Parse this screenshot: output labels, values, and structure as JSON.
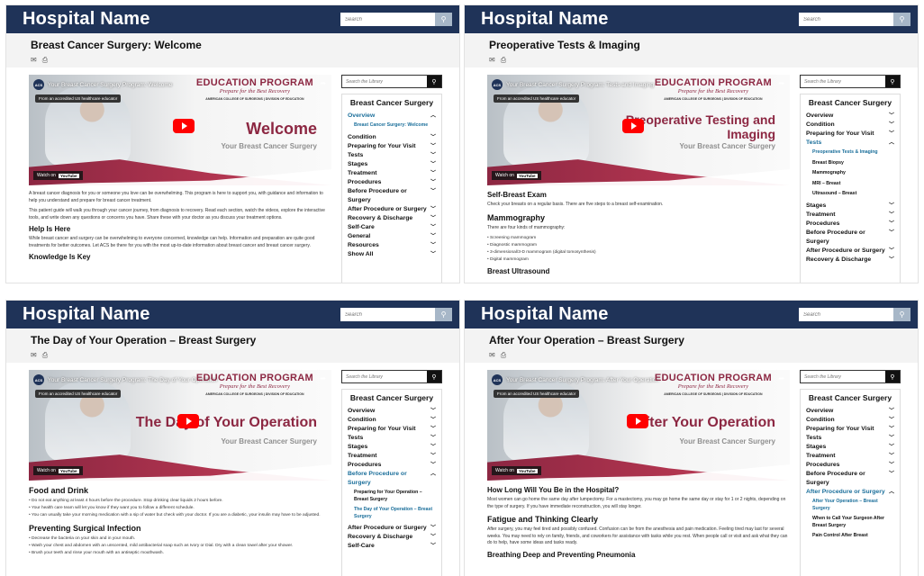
{
  "brand": "Hospital Name",
  "search_placeholder": "Search",
  "library_search_placeholder": "Search the Library",
  "panels": [
    {
      "page_title": "Breast Cancer Surgery: Welcome",
      "video": {
        "title": "Your Breast Cancer Surgery Program: Welcome",
        "edu_tag": "From an accredited US healthcare educator",
        "main_text": "Welcome",
        "sub_text": "Your Breast Cancer Surgery",
        "watch": "Watch on",
        "youtube": "YouTube"
      },
      "content": {
        "p1": "A breast cancer diagnosis for you or someone you love can be overwhelming. This program is here to support you, with guidance and information to help you understand and prepare for breast cancer treatment.",
        "p2": "This patient guide will walk you through your cancer journey, from diagnosis to recovery. Read each section, watch the videos, explore the interactive tools, and write down any questions or concerns you have. Share these with your doctor as you discuss your treatment options.",
        "h1": "Help Is Here",
        "p3": "While breast cancer and surgery can be overwhelming to everyone concerned, knowledge can help. Information and preparation are quite good treatments for better outcomes. Let ACS be there for you with the most up-to-date information about breast cancer and breast cancer surgery.",
        "h2": "Knowledge Is Key"
      },
      "nav": {
        "title": "Breast Cancer Surgery",
        "items": [
          {
            "label": "Overview",
            "chev": "︿",
            "active": true
          },
          {
            "label": "Condition",
            "chev": "﹀"
          },
          {
            "label": "Preparing for Your Visit",
            "chev": "﹀"
          },
          {
            "label": "Tests",
            "chev": "﹀"
          },
          {
            "label": "Stages",
            "chev": "﹀"
          },
          {
            "label": "Treatment",
            "chev": "﹀"
          },
          {
            "label": "Procedures",
            "chev": "﹀"
          },
          {
            "label": "Before Procedure or Surgery",
            "chev": "﹀"
          },
          {
            "label": "After Procedure or Surgery",
            "chev": "﹀"
          },
          {
            "label": "Recovery & Discharge",
            "chev": "﹀"
          },
          {
            "label": "Self-Care",
            "chev": "﹀"
          },
          {
            "label": "General",
            "chev": "﹀"
          },
          {
            "label": "Resources",
            "chev": "﹀"
          },
          {
            "label": "Show All",
            "chev": "﹀"
          }
        ],
        "sub": [
          "Breast Cancer Surgery: Welcome"
        ]
      }
    },
    {
      "page_title": "Preoperative Tests & Imaging",
      "video": {
        "title": "Your Breast Cancer Surgery Program: Tests and Imaging",
        "edu_tag": "From an accredited US healthcare educator",
        "main_text": "Preoperative Testing and Imaging",
        "sub_text": "Your Breast Cancer Surgery",
        "watch": "Watch on",
        "youtube": "YouTube"
      },
      "content": {
        "h1": "Self-Breast Exam",
        "p1": "Check your breasts on a regular basis. There are five steps to a breast self-examination.",
        "h2": "Mammography",
        "p2": "There are four kinds of mammography:",
        "list": [
          "Screening mammogram",
          "Diagnostic mammogram",
          "3-dimensional/3-D mammogram (digital tomosynthesis)",
          "Digital mammogram"
        ],
        "h3": "Breast Ultrasound"
      },
      "nav": {
        "title": "Breast Cancer Surgery",
        "items": [
          {
            "label": "Overview",
            "chev": "﹀"
          },
          {
            "label": "Condition",
            "chev": "﹀"
          },
          {
            "label": "Preparing for Your Visit",
            "chev": "﹀"
          },
          {
            "label": "Tests",
            "chev": "︿",
            "active": true
          },
          {
            "label": "Stages",
            "chev": "﹀"
          },
          {
            "label": "Treatment",
            "chev": "﹀"
          },
          {
            "label": "Procedures",
            "chev": "﹀"
          },
          {
            "label": "Before Procedure or Surgery",
            "chev": "﹀"
          },
          {
            "label": "After Procedure or Surgery",
            "chev": "﹀"
          },
          {
            "label": "Recovery & Discharge",
            "chev": "﹀"
          }
        ],
        "sub": [
          "Preoperative Tests & Imaging",
          "Breast Biopsy",
          "Mammography",
          "MRI – Breast",
          "Ultrasound – Breast"
        ]
      }
    },
    {
      "page_title": "The Day of Your Operation – Breast Surgery",
      "video": {
        "title": "Your Breast Cancer Surgery Program: The Day of Your Operation",
        "edu_tag": "From an accredited US healthcare educator",
        "main_text": "The Day of Your Operation",
        "sub_text": "Your Breast Cancer Surgery",
        "watch": "Watch on",
        "youtube": "YouTube"
      },
      "content": {
        "h1": "Food and Drink",
        "list": [
          "Do not eat anything at least 4 hours before the procedure. Stop drinking clear liquids 2 hours before.",
          "Your health care team will let you know if they want you to follow a different schedule.",
          "You can usually take your morning medication with a sip of water but check with your doctor. If you are a diabetic, your insulin may have to be adjusted."
        ],
        "h2": "Preventing Surgical Infection",
        "list2": [
          "Decrease the bacteria on your skin and in your mouth.",
          "Wash your chest and abdomen with an unscented, mild antibacterial soap such as Ivory or Dial. Dry with a clean towel after your shower.",
          "Brush your teeth and rinse your mouth with an antiseptic mouthwash."
        ]
      },
      "nav": {
        "title": "Breast Cancer Surgery",
        "items": [
          {
            "label": "Overview",
            "chev": "﹀"
          },
          {
            "label": "Condition",
            "chev": "﹀"
          },
          {
            "label": "Preparing for Your Visit",
            "chev": "﹀"
          },
          {
            "label": "Tests",
            "chev": "﹀"
          },
          {
            "label": "Stages",
            "chev": "﹀"
          },
          {
            "label": "Treatment",
            "chev": "﹀"
          },
          {
            "label": "Procedures",
            "chev": "﹀"
          },
          {
            "label": "Before Procedure or Surgery",
            "chev": "︿",
            "active": true
          },
          {
            "label": "After Procedure or Surgery",
            "chev": "﹀"
          },
          {
            "label": "Recovery & Discharge",
            "chev": "﹀"
          },
          {
            "label": "Self-Care",
            "chev": "﹀"
          }
        ],
        "sub": [
          "Preparing for Your Operation – Breast Surgery",
          "The Day of Your Operation – Breast Surgery"
        ]
      }
    },
    {
      "page_title": "After Your Operation – Breast Surgery",
      "video": {
        "title": "Your Breast Cancer Surgery Program: After Your Operation",
        "edu_tag": "From an accredited US healthcare educator",
        "main_text": "After Your Operation",
        "sub_text": "Your Breast Cancer Surgery",
        "watch": "Watch on",
        "youtube": "YouTube"
      },
      "content": {
        "h1": "How Long Will You Be in the Hospital?",
        "p1": "Most women can go home the same day after lumpectomy. For a mastectomy, you may go home the same day or stay for 1 or 2 nights, depending on the type of surgery. If you have immediate reconstruction, you will stay longer.",
        "h2": "Fatigue and Thinking Clearly",
        "p2": "After surgery, you may feel tired and possibly confused. Confusion can be from the anesthesia and pain medication. Feeling tired may last for several weeks. You may need to rely on family, friends, and coworkers for assistance with tasks while you rest. When people call or visit and ask what they can do to help, have some ideas and tasks ready.",
        "h3": "Breathing Deep and Preventing Pneumonia"
      },
      "nav": {
        "title": "Breast Cancer Surgery",
        "items": [
          {
            "label": "Overview",
            "chev": "﹀"
          },
          {
            "label": "Condition",
            "chev": "﹀"
          },
          {
            "label": "Preparing for Your Visit",
            "chev": "﹀"
          },
          {
            "label": "Tests",
            "chev": "﹀"
          },
          {
            "label": "Stages",
            "chev": "﹀"
          },
          {
            "label": "Treatment",
            "chev": "﹀"
          },
          {
            "label": "Procedures",
            "chev": "﹀"
          },
          {
            "label": "Before Procedure or Surgery",
            "chev": "﹀"
          },
          {
            "label": "After Procedure or Surgery",
            "chev": "︿",
            "active": true
          }
        ],
        "sub": [
          "After Your Operation – Breast Surgery",
          "When to Call Your Surgeon After Breast Surgery",
          "Pain Control After Breast"
        ]
      }
    }
  ]
}
